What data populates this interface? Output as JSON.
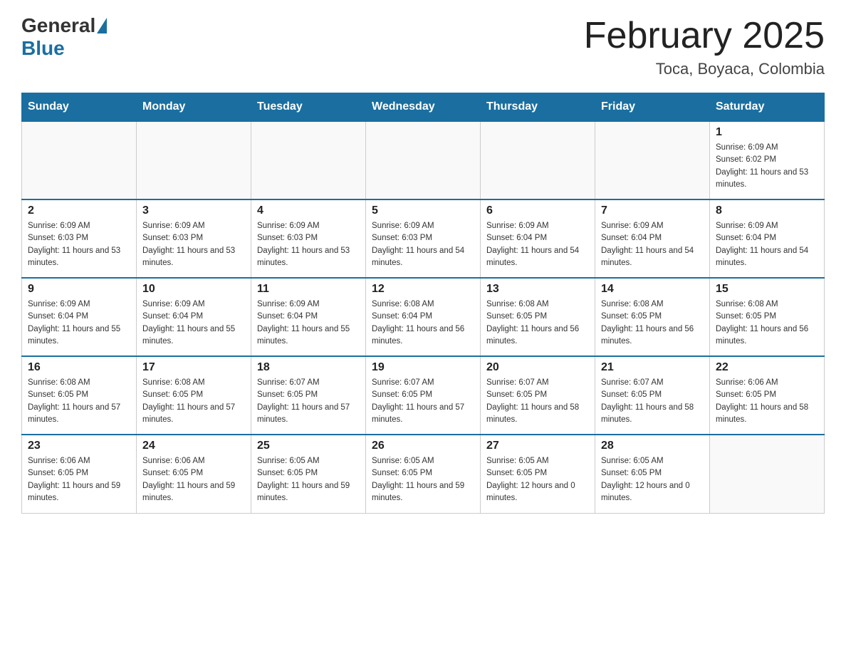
{
  "header": {
    "logo_general": "General",
    "logo_blue": "Blue",
    "month_title": "February 2025",
    "location": "Toca, Boyaca, Colombia"
  },
  "weekdays": [
    "Sunday",
    "Monday",
    "Tuesday",
    "Wednesday",
    "Thursday",
    "Friday",
    "Saturday"
  ],
  "weeks": [
    [
      {
        "day": "",
        "sunrise": "",
        "sunset": "",
        "daylight": ""
      },
      {
        "day": "",
        "sunrise": "",
        "sunset": "",
        "daylight": ""
      },
      {
        "day": "",
        "sunrise": "",
        "sunset": "",
        "daylight": ""
      },
      {
        "day": "",
        "sunrise": "",
        "sunset": "",
        "daylight": ""
      },
      {
        "day": "",
        "sunrise": "",
        "sunset": "",
        "daylight": ""
      },
      {
        "day": "",
        "sunrise": "",
        "sunset": "",
        "daylight": ""
      },
      {
        "day": "1",
        "sunrise": "Sunrise: 6:09 AM",
        "sunset": "Sunset: 6:02 PM",
        "daylight": "Daylight: 11 hours and 53 minutes."
      }
    ],
    [
      {
        "day": "2",
        "sunrise": "Sunrise: 6:09 AM",
        "sunset": "Sunset: 6:03 PM",
        "daylight": "Daylight: 11 hours and 53 minutes."
      },
      {
        "day": "3",
        "sunrise": "Sunrise: 6:09 AM",
        "sunset": "Sunset: 6:03 PM",
        "daylight": "Daylight: 11 hours and 53 minutes."
      },
      {
        "day": "4",
        "sunrise": "Sunrise: 6:09 AM",
        "sunset": "Sunset: 6:03 PM",
        "daylight": "Daylight: 11 hours and 53 minutes."
      },
      {
        "day": "5",
        "sunrise": "Sunrise: 6:09 AM",
        "sunset": "Sunset: 6:03 PM",
        "daylight": "Daylight: 11 hours and 54 minutes."
      },
      {
        "day": "6",
        "sunrise": "Sunrise: 6:09 AM",
        "sunset": "Sunset: 6:04 PM",
        "daylight": "Daylight: 11 hours and 54 minutes."
      },
      {
        "day": "7",
        "sunrise": "Sunrise: 6:09 AM",
        "sunset": "Sunset: 6:04 PM",
        "daylight": "Daylight: 11 hours and 54 minutes."
      },
      {
        "day": "8",
        "sunrise": "Sunrise: 6:09 AM",
        "sunset": "Sunset: 6:04 PM",
        "daylight": "Daylight: 11 hours and 54 minutes."
      }
    ],
    [
      {
        "day": "9",
        "sunrise": "Sunrise: 6:09 AM",
        "sunset": "Sunset: 6:04 PM",
        "daylight": "Daylight: 11 hours and 55 minutes."
      },
      {
        "day": "10",
        "sunrise": "Sunrise: 6:09 AM",
        "sunset": "Sunset: 6:04 PM",
        "daylight": "Daylight: 11 hours and 55 minutes."
      },
      {
        "day": "11",
        "sunrise": "Sunrise: 6:09 AM",
        "sunset": "Sunset: 6:04 PM",
        "daylight": "Daylight: 11 hours and 55 minutes."
      },
      {
        "day": "12",
        "sunrise": "Sunrise: 6:08 AM",
        "sunset": "Sunset: 6:04 PM",
        "daylight": "Daylight: 11 hours and 56 minutes."
      },
      {
        "day": "13",
        "sunrise": "Sunrise: 6:08 AM",
        "sunset": "Sunset: 6:05 PM",
        "daylight": "Daylight: 11 hours and 56 minutes."
      },
      {
        "day": "14",
        "sunrise": "Sunrise: 6:08 AM",
        "sunset": "Sunset: 6:05 PM",
        "daylight": "Daylight: 11 hours and 56 minutes."
      },
      {
        "day": "15",
        "sunrise": "Sunrise: 6:08 AM",
        "sunset": "Sunset: 6:05 PM",
        "daylight": "Daylight: 11 hours and 56 minutes."
      }
    ],
    [
      {
        "day": "16",
        "sunrise": "Sunrise: 6:08 AM",
        "sunset": "Sunset: 6:05 PM",
        "daylight": "Daylight: 11 hours and 57 minutes."
      },
      {
        "day": "17",
        "sunrise": "Sunrise: 6:08 AM",
        "sunset": "Sunset: 6:05 PM",
        "daylight": "Daylight: 11 hours and 57 minutes."
      },
      {
        "day": "18",
        "sunrise": "Sunrise: 6:07 AM",
        "sunset": "Sunset: 6:05 PM",
        "daylight": "Daylight: 11 hours and 57 minutes."
      },
      {
        "day": "19",
        "sunrise": "Sunrise: 6:07 AM",
        "sunset": "Sunset: 6:05 PM",
        "daylight": "Daylight: 11 hours and 57 minutes."
      },
      {
        "day": "20",
        "sunrise": "Sunrise: 6:07 AM",
        "sunset": "Sunset: 6:05 PM",
        "daylight": "Daylight: 11 hours and 58 minutes."
      },
      {
        "day": "21",
        "sunrise": "Sunrise: 6:07 AM",
        "sunset": "Sunset: 6:05 PM",
        "daylight": "Daylight: 11 hours and 58 minutes."
      },
      {
        "day": "22",
        "sunrise": "Sunrise: 6:06 AM",
        "sunset": "Sunset: 6:05 PM",
        "daylight": "Daylight: 11 hours and 58 minutes."
      }
    ],
    [
      {
        "day": "23",
        "sunrise": "Sunrise: 6:06 AM",
        "sunset": "Sunset: 6:05 PM",
        "daylight": "Daylight: 11 hours and 59 minutes."
      },
      {
        "day": "24",
        "sunrise": "Sunrise: 6:06 AM",
        "sunset": "Sunset: 6:05 PM",
        "daylight": "Daylight: 11 hours and 59 minutes."
      },
      {
        "day": "25",
        "sunrise": "Sunrise: 6:05 AM",
        "sunset": "Sunset: 6:05 PM",
        "daylight": "Daylight: 11 hours and 59 minutes."
      },
      {
        "day": "26",
        "sunrise": "Sunrise: 6:05 AM",
        "sunset": "Sunset: 6:05 PM",
        "daylight": "Daylight: 11 hours and 59 minutes."
      },
      {
        "day": "27",
        "sunrise": "Sunrise: 6:05 AM",
        "sunset": "Sunset: 6:05 PM",
        "daylight": "Daylight: 12 hours and 0 minutes."
      },
      {
        "day": "28",
        "sunrise": "Sunrise: 6:05 AM",
        "sunset": "Sunset: 6:05 PM",
        "daylight": "Daylight: 12 hours and 0 minutes."
      },
      {
        "day": "",
        "sunrise": "",
        "sunset": "",
        "daylight": ""
      }
    ]
  ]
}
